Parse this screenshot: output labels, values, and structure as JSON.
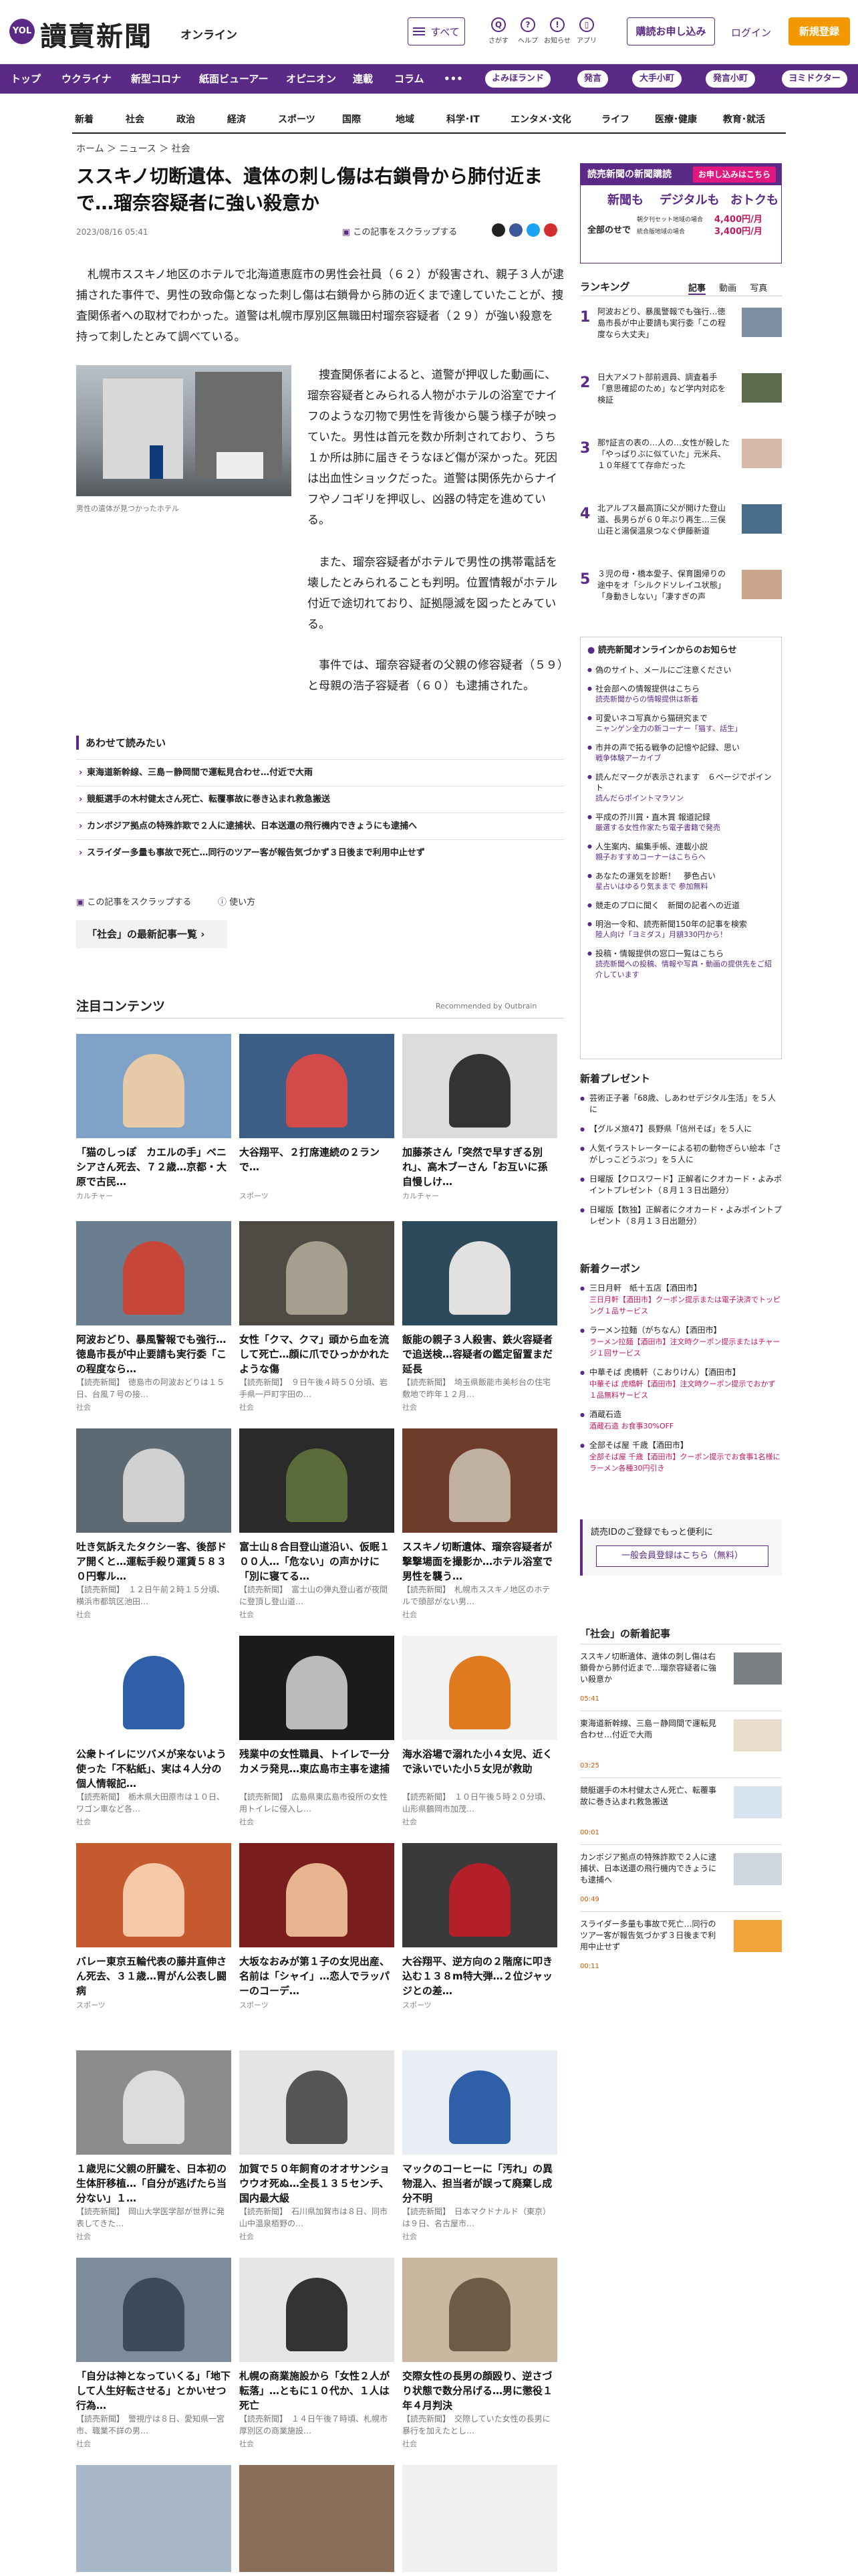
{
  "header": {
    "logo_mark": "YOL",
    "logo_text": "讀賣新聞",
    "logo_sub": "オンライン",
    "menu_label": "すべて",
    "icons": [
      {
        "name": "search-icon",
        "label": "さがす",
        "glyph": "Q"
      },
      {
        "name": "help-icon",
        "label": "ヘルプ",
        "glyph": "?"
      },
      {
        "name": "bell-icon",
        "label": "お知らせ",
        "glyph": "!"
      },
      {
        "name": "app-icon",
        "label": "アプリ",
        "glyph": "▯"
      }
    ],
    "subscribe_label": "購読お申し込み",
    "login_label": "ログイン",
    "register_label": "新規登録"
  },
  "nav_main": {
    "items": [
      "トップ",
      "ウクライナ",
      "新型コロナ",
      "紙面ビューアー",
      "オピニオン",
      "連載",
      "コラム",
      "•••"
    ],
    "pills": [
      "よみほランド",
      "発言",
      "大手小町",
      "発言小町",
      "ヨミドクター"
    ]
  },
  "nav_sub": {
    "items": [
      "新着",
      "社会",
      "政治",
      "経済",
      "スポーツ",
      "国際",
      "地域",
      "科学･IT",
      "エンタメ･文化",
      "ライフ",
      "医療･健康",
      "教育･就活"
    ]
  },
  "breadcrumb": "ホーム ＞ ニュース ＞ 社会",
  "article": {
    "title": "ススキノ切断遺体、遺体の刺し傷は右鎖骨から肺付近まで…瑠奈容疑者に強い殺意か",
    "date": "2023/08/16 05:41",
    "scrap_label": "この記事をスクラップする",
    "lead": "札幌市ススキノ地区のホテルで北海道恵庭市の男性会社員（６２）が殺害され、親子３人が逮捕された事件で、男性の致命傷となった刺し傷は右鎖骨から肺の近くまで達していたことが、捜査関係者への取材でわかった。道警は札幌市厚別区無職田村瑠奈容疑者（２９）が強い殺意を持って刺したとみて調べている。",
    "photo_caption": "男性の遺体が見つかったホテル",
    "paragraphs": [
      "捜査関係者によると、道警が押収した動画に、瑠奈容疑者とみられる人物がホテルの浴室でナイフのような刃物で男性を背後から襲う様子が映っていた。男性は首元を数か所刺されており、うち１か所は肺に届きそうなほど傷が深かった。死因は出血性ショックだった。道警は関係先からナイフやノコギリを押収し、凶器の特定を進めている。",
      "また、瑠奈容疑者がホテルで男性の携帯電話を壊したとみられることも判明。位置情報がホテル付近で途切れており、証拠隠滅を図ったとみている。",
      "事件では、瑠奈容疑者の父親の修容疑者（５９）と母親の浩子容疑者（６０）も逮捕された。"
    ],
    "also_read_heading": "あわせて読みたい",
    "also_read": [
      "東海道新幹線、三島－静岡間で運転見合わせ…付近で大雨",
      "競艇選手の木村健太さん死亡、転覆事故に巻き込まれ救急搬送",
      "カンボジア拠点の特殊詐欺で２人に逮捕状、日本送還の飛行機内できょうにも逮捕へ",
      "スライダー多量も事故で死亡…同行のツアー客が報告気づかず３日後まで利用中止せず"
    ],
    "scrap_footer": "この記事をスクラップする",
    "howto_label": "使い方",
    "more_button": "「社会」の最新記事一覧"
  },
  "recommend": {
    "heading": "注目コンテンツ",
    "by": "Recommended by Outbrain",
    "cards": [
      {
        "title": "「猫のしっぽ　カエルの手」ベニシアさん死去、７２歳…京都・大原で古民…",
        "desc": "",
        "source": "カルチャー",
        "bg": "#7fa3c6",
        "fg": "#e8c9a8"
      },
      {
        "title": "大谷翔平、２打席連続の２ランで…",
        "desc": "",
        "source": "スポーツ",
        "bg": "#3c5d86",
        "fg": "#d24a4a"
      },
      {
        "title": "加藤茶さん「突然で早すぎる別れ」、高木ブーさん「お互いに孫自慢しけ…",
        "desc": "",
        "source": "カルチャー",
        "bg": "#dcdcdc",
        "fg": "#333333"
      },
      {
        "title": "阿波おどり、暴風警報でも強行…徳島市長が中止要請も実行委「この程度なら…",
        "desc": "【読売新聞】　徳島市の阿波おどりは１５日、台風７号の接…",
        "source": "社会",
        "bg": "#6b7e8f",
        "fg": "#c7463a"
      },
      {
        "title": "女性「クマ、クマ」頭から血を流して死亡…顔に爪でひっかかれたような傷",
        "desc": "【読売新聞】　９日午後４時５０分頃、岩手県一戸町字田の…",
        "source": "社会",
        "bg": "#4e4a44",
        "fg": "#a69e8e"
      },
      {
        "title": "飯能の親子３人殺害、鉄火容疑者で追送検…容疑者の鑑定留置まだ延長",
        "desc": "【読売新聞】　埼玉県飯能市美杉台の住宅敷地で昨年１２月…",
        "source": "社会",
        "bg": "#2c4a5a",
        "fg": "#e1e1e1"
      },
      {
        "title": "吐き気訴えたタクシー客、後部ドア開くと…運転手殺り運賃５８３０円奪ル…",
        "desc": "【読売新聞】　１２日午前２時１５分頃、横浜市都筑区池田…",
        "source": "社会",
        "bg": "#5e6a73",
        "fg": "#d0d0d0"
      },
      {
        "title": "富士山８合目登山道沿い、仮眠１００人…「危ない」の声かけに「別に寝てる…",
        "desc": "【読売新聞】　富士山の弾丸登山者が夜間に登頂し登山道…",
        "source": "社会",
        "bg": "#2a2a2a",
        "fg": "#5c6b3a"
      },
      {
        "title": "ススキノ切断遺体、瑠奈容疑者が撃撃場面を撮影か…ホテル浴室で男性を襲う…",
        "desc": "【読売新聞】　札幌市ススキノ地区のホテルで頭部がない男…",
        "source": "社会",
        "bg": "#6d3c2a",
        "fg": "#c0b0a0"
      },
      {
        "title": "公衆トイレにツバメが来ないよう使った「不粘紙」、実は４人分の個人情報記…",
        "desc": "【読売新聞】　栃木県大田原市は１０日、ワゴン車など各…",
        "source": "社会",
        "bg": "#ffffff",
        "fg": "#2f5fa8"
      },
      {
        "title": "残業中の女性職員、トイレで一分カメラ発見…東広島市主事を逮捕",
        "desc": "【読売新聞】　広島県東広島市役所の女性用トイレに侵入し…",
        "source": "社会",
        "bg": "#1b1b1b",
        "fg": "#bbbbbb"
      },
      {
        "title": "海水浴場で溺れた小４女児、近くで泳いでいた小５女児が救助",
        "desc": "【読売新聞】　１０日午後５時２０分頃、山形県鶴岡市加茂…",
        "source": "社会",
        "bg": "#f2f2f2",
        "fg": "#e07a1f"
      },
      {
        "title": "バレー東京五輪代表の藤井直伸さん死去、３１歳…胃がん公表し闘病",
        "desc": "",
        "source": "スポーツ",
        "bg": "#c45a2d",
        "fg": "#f5c9a8"
      },
      {
        "title": "大坂なおみが第１子の女児出産、名前は「シャイ」…恋人でラッパーのコーデ…",
        "desc": "",
        "source": "スポーツ",
        "bg": "#7a1d1d",
        "fg": "#e6b48f"
      },
      {
        "title": "大谷翔平、逆方向の２階席に叩き込む１３８m特大弾…２位ジャッジとの差…",
        "desc": "",
        "source": "スポーツ",
        "bg": "#3a3a3a",
        "fg": "#b4202a"
      },
      {
        "title": "１歳児に父親の肝臓を、日本初の生体肝移植…「自分が逃げたら当分ない」１…",
        "desc": "【読売新聞】　岡山大学医学部が世界に発表してきた…",
        "source": "社会",
        "bg": "#8c8c8c",
        "fg": "#dcdcdc"
      },
      {
        "title": "加賀で５０年飼育のオオサンショウウオ死ぬ…全長１３５センチ、国内最大級",
        "desc": "【読売新聞】　石川県加賀市は８日、同市山中温泉栢野の…",
        "source": "社会",
        "bg": "#e4e4e4",
        "fg": "#555555"
      },
      {
        "title": "マックのコーヒーに「汚れ」の異物混入、担当者が誤って廃棄し成分不明",
        "desc": "【読売新聞】　日本マクドナルド（東京）は９日、名古屋市…",
        "source": "社会",
        "bg": "#e9eef5",
        "fg": "#2f5fa8"
      },
      {
        "title": "「自分は神となっていくる」「地下して人生好転させる」とかいせつ行為…",
        "desc": "【読売新聞】　警視庁は８日、愛知県一宮市、職業不詳の男…",
        "source": "社会",
        "bg": "#7d8c9a",
        "fg": "#3a4a5a"
      },
      {
        "title": "札幌の商業施設から「女性２人が転落」…ともに１０代か、１人は死亡",
        "desc": "【読売新聞】　１４日午後７時頃、札幌市厚別区の商業施設…",
        "source": "社会",
        "bg": "#e6e6e6",
        "fg": "#333333"
      },
      {
        "title": "交際女性の長男の顔殴り、逆さづり状態で数分吊げる…男に懲役１年４月判決",
        "desc": "【読売新聞】　交際していた女性の長男に暴行を加えたとし…",
        "source": "社会",
        "bg": "#c9b79f",
        "fg": "#6e5b45"
      }
    ],
    "last_row_bg": [
      "#a8b8c8",
      "#8a6e5a",
      "#f0f0f0"
    ]
  },
  "sidebar": {
    "promo": {
      "title": "読売新聞の新聞購読",
      "offer": "お申し込みはこちら",
      "features": [
        "新聞も",
        "デジタルも",
        "おトクも"
      ],
      "tagline": "全部のせで",
      "price_line1": "4,400円/月",
      "price_line2": "3,400円/月",
      "price_note1": "朝夕刊セット地域の場合",
      "price_note2": "統合版地域の場合"
    },
    "ranking_heading": "ランキング",
    "ranking_tabs": [
      "記事",
      "動画",
      "写真"
    ],
    "ranking": [
      {
        "n": "1",
        "title": "阿波おどり、暴風警報でも強行…徳島市長が中止要請も実行委「この程度なら大丈夫」",
        "color": "#7d8fa0"
      },
      {
        "title": "日大アメフト部前週員、調査着手「意思確認のため」など学内対応を検証",
        "n": "2",
        "color": "#5c6b4e"
      },
      {
        "n": "3",
        "title": "那ｻ証言の表の…人の…女性が殺した「やっぱりぶに似ていた」元米兵、１０年経てて存命だった",
        "color": "#d8b8a8"
      },
      {
        "n": "4",
        "title": "北アルプス最高頂に父が開けた登山道、長男らが６０年ぶり再生…三俣山荘と湯俣温泉つなぐ伊藤新道",
        "color": "#4a6e8a"
      },
      {
        "n": "5",
        "title": "３児の母・橋本愛子、保育園帰りの途中をオ「シルクドソレイユ状態」「身動きしない」「凄すぎの声",
        "color": "#caa78c"
      }
    ],
    "notice_heading": "読売新聞オンラインからのお知らせ",
    "notices": [
      {
        "title": "偽のサイト、メールにご注意ください",
        "sub": ""
      },
      {
        "title": "社会部への情報提供はこちら",
        "sub": "読売新聞からの情報提供は新着"
      },
      {
        "title": "可愛いネコ写真から猫研究まで",
        "sub": "ニャンゲン全力の新コーナー「猫す、話生」"
      },
      {
        "title": "市井の声で拓る戦争の記憶や記録、思い",
        "sub": "戦争体験アーカイブ"
      },
      {
        "title": "読んだマークが表示されます　６ページでポイント",
        "sub": "読んだらポイントマラソン"
      },
      {
        "title": "平成の芥川賞・直木賞 報道記録",
        "sub": "厳選する女性作家たち電子書籍で発売"
      },
      {
        "title": "人生案内、編集手帳、連載小説",
        "sub": "親子おすすめコーナーはこちらへ"
      },
      {
        "title": "あなたの運気を診断！　夢色占い",
        "sub": "星占いはゆるり気ままで 参加無料"
      },
      {
        "title": "競走のプロに聞く　新聞の記者への近道",
        "sub": ""
      },
      {
        "title": "明治一令和、読売新聞150年の記事を検索",
        "sub": "陸人向け「ヨミダス」月額330円から！"
      },
      {
        "title": "投稿・情報提供の窓口一覧はこちら",
        "sub": "読売新聞への投稿、情報や写真・動画の提供先をご紹介しています"
      }
    ],
    "new_heading": "新着プレゼント",
    "new_items": [
      "芸術正子著「68歳、しあわせデジタル生活」を５人に",
      "【グルメ旅47】長野県「信州そば」を５人に",
      "人気イラストレーターによる初の動物ぎらい絵本「さがしっこどうぶつ」を５人に",
      "日曜版【クロスワード】正解者にクオカード・よみポイントプレゼント（８月１３日出題分）",
      "日曜版【数独】正解者にクオカード・よみポイントプレゼント（８月１３日出題分）"
    ],
    "coupon_heading": "新着クーポン",
    "coupons": [
      {
        "title": "三日月軒　紙十五店【酒田市】",
        "sub": "三日月軒【酒田市】クーポン提示または電子決済でトッピング１品サービス"
      },
      {
        "title": "ラーメン拉麺（がちなん）【酒田市】",
        "sub": "ラーメン拉麺【酒田市】注文時クーポン提示またはチャージ１回サービス"
      },
      {
        "title": "中華そば 虎橋軒（こおりけん）【酒田市】",
        "sub": "中華そば 虎橋軒【酒田市】注文時クーポン提示でおかず１品無料サービス"
      },
      {
        "title": "酒蔵石造",
        "sub": "酒蔵石造 お食事30%OFF"
      },
      {
        "title": "全部そば屋 千歳【酒田市】",
        "sub": "全部そば屋 千歳【酒田市】クーポン提示でお食事1名様にラーメン各種30円引き"
      }
    ],
    "login_text": "読売IDのご登録でもっと便利に",
    "login_button": "一般会員登録はこちら（無料）",
    "latest_heading": "「社会」の新着記事",
    "latest": [
      {
        "title": "ススキノ切断遺体、遺体の刺し傷は右鎖骨から肺付近まで…瑠奈容疑者に強い殺意か",
        "time": "05:41",
        "color": "#7a7f83"
      },
      {
        "title": "東海道新幹線、三島－静岡間で運転見合わせ…付近で大雨",
        "time": "03:25",
        "color": "#e8dccc"
      },
      {
        "title": "競艇選手の木村健太さん死亡、転覆事故に巻き込まれ救急搬送",
        "time": "00:01",
        "color": "#d8e4f0"
      },
      {
        "title": "カンボジア拠点の特殊詐欺で２人に逮捕状、日本送還の飛行機内できょうにも逮捕へ",
        "time": "00:49",
        "color": "#cfd6dd"
      },
      {
        "title": "スライダー多量も事故で死亡…同行のツアー客が報告気づかず３日後まで利用中止せず",
        "time": "00:11",
        "color": "#f0a43a"
      }
    ]
  }
}
